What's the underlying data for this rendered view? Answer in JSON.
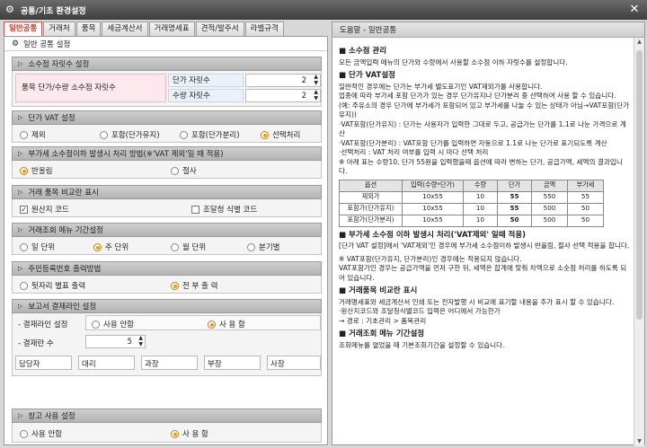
{
  "window": {
    "title": "공통/기초 환경설정",
    "close": "✕"
  },
  "tabs": [
    "일반공통",
    "거래처",
    "품목",
    "세금계산서",
    "거래명세표",
    "견적/발주서",
    "라벨규격"
  ],
  "panel_title": "일반 공통 설정",
  "sections": {
    "decimal": {
      "title": "소수점 자릿수 설정",
      "label": "품목 단가/수량 소수점 자릿수",
      "unit_label": "단가 자릿수",
      "unit_value": "2",
      "qty_label": "수량 자릿수",
      "qty_value": "2"
    },
    "vat": {
      "title": "단가 VAT 설정",
      "options": [
        "제외",
        "포함(단가유지)",
        "포함(단가분리)",
        "선택처리"
      ],
      "selected": 3
    },
    "rounding": {
      "title": "부가세 소수점이하 발생시 처리 방법(※'VAT 제외'일 때 적용)",
      "options": [
        "반올림",
        "절사"
      ],
      "selected": 0
    },
    "compare": {
      "title": "거래 품목 비교란 표시",
      "options": [
        "원산지 코드",
        "조달청 식별 코드"
      ],
      "checked": [
        true,
        false
      ]
    },
    "period": {
      "title": "거래조회 메뉴 기간설정",
      "options": [
        "일 단위",
        "주 단위",
        "월 단위",
        "분기별"
      ],
      "selected": 1
    },
    "resident": {
      "title": "주민등록번호 출력방법",
      "options": [
        "뒷자리 별표 출력",
        "전 부 출 력"
      ],
      "selected": 1
    },
    "approval": {
      "title": "보고서 결재라인 설정",
      "line_label": "- 결재라인 설정",
      "options": [
        "사용 안함",
        "사 용 함"
      ],
      "selected": 1,
      "count_label": "- 결재란 수",
      "count_value": "5",
      "roles": [
        "담당자",
        "대리",
        "과장",
        "부장",
        "사장"
      ]
    },
    "warehouse": {
      "title": "창고 사용 설정",
      "options": [
        "사용 안함",
        "사 용 함"
      ],
      "selected": 1
    }
  },
  "help": {
    "title": "도움말 - 일반공통",
    "h1": "소수점 관리",
    "p1": "모든 금액입력 메뉴의 단가와 수량에서 사용할 소수점 이하 자릿수를 설정합니다.",
    "h2": "단가 VAT설정",
    "p2a": "일반적인 경우에는 단가는 부가세 별도표기인 VAT제외가를 사용합니다.",
    "p2b": "업종에 따라 부가세 포함 단가가 있는 경우 단가유지나 단가분리 중 선택하여 사용 할 수 있습니다.",
    "p2c": "(예: 주유소의 경우 단가에 부가세가 포함되어 있고 부가세를 나눌 수 있는 상태가 아님→VAT포함(단가유지))",
    "p2d": "·VAT포함(단가유지) : 단가는 사용자가 입력한 그대로 두고, 공급가는 단가를 1.1로 나눈 가격으로 계산",
    "p2e": "·VAT포함(단가분리) : VAT포함 단가를 입력하면 자동으로 1.1로 나눈 단가로 표기되도록 계산",
    "p2f": "·선택처리 : VAT 처리 여부를 입력 시 마다 선택 처리",
    "p2g": "※ 아래 표는 수량10, 단가 55원을 입력했을때 옵션에 따라 변하는 단가, 공급가액, 세액의 결과입니다.",
    "table_head": [
      "옵션",
      "입력(수량*단가)",
      "수량",
      "단가",
      "금액",
      "부가세"
    ],
    "table_rows": [
      [
        "제외가",
        "10x55",
        "10",
        "55",
        "550",
        "55"
      ],
      [
        "포함가(단가유지)",
        "10x55",
        "10",
        "55",
        "500",
        "50"
      ],
      [
        "포함가(단가분리)",
        "10x55",
        "10",
        "50",
        "500",
        "50"
      ]
    ],
    "h3": "부가세 소수점 이하 발생시 처리('VAT제외' 일때 적용)",
    "p3a": "[단가 VAT 설정]에서 'VAT제외'인 경우에 부가세 소수점이하 발생시 반올림, 절사 선택 적용을 합니다.",
    "p3b": "※ VAT포함(단가유지, 단가분리)인 경우에는 적용되지 않습니다.",
    "p3c": "VAT포함가인 경우는 공급가액을 먼저 구한 뒤, 세액은 합계에 맞춰 차액으로 소숫점 처리를 하도록 되어 있습니다.",
    "h4": "거래품목 비교란 표시",
    "p4a": "거래명세표와 세금계산서 인쇄 또는 전자발행 시 비교에 표기할 내용을 추가 표시 할 수 있습니다.",
    "p4b": "·원산지코드와 조달청식별코드 입력은 어디에서 가능한가",
    "p4c": "→ 경로 : 기초관리 > 품목관리",
    "h5": "거래조회 메뉴 기간설정",
    "p5": "조회메뉴를 열었을 때 기본조회기간을 설정할 수 있습니다."
  }
}
